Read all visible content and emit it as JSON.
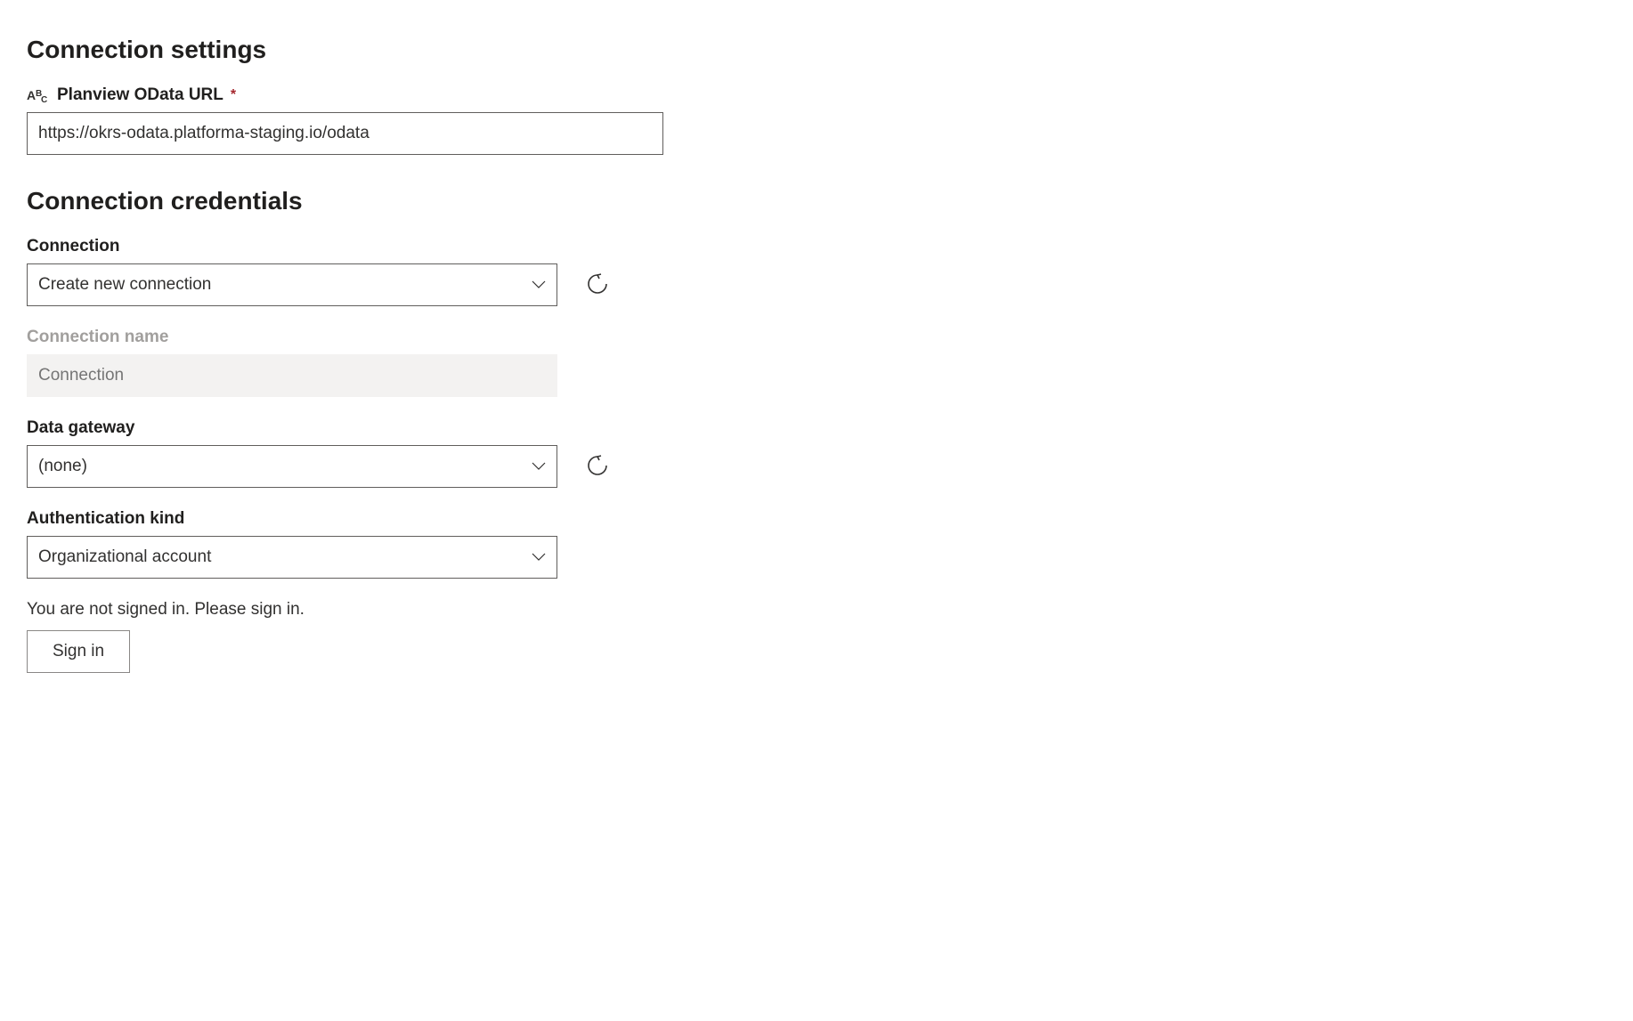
{
  "settings": {
    "heading": "Connection settings",
    "url_label": "Planview OData URL",
    "url_required": "*",
    "url_value": "https://okrs-odata.platforma-staging.io/odata"
  },
  "credentials": {
    "heading": "Connection credentials",
    "connection_label": "Connection",
    "connection_value": "Create new connection",
    "connection_name_label": "Connection name",
    "connection_name_placeholder": "Connection",
    "gateway_label": "Data gateway",
    "gateway_value": "(none)",
    "auth_label": "Authentication kind",
    "auth_value": "Organizational account",
    "signin_message": "You are not signed in. Please sign in.",
    "signin_button": "Sign in"
  }
}
